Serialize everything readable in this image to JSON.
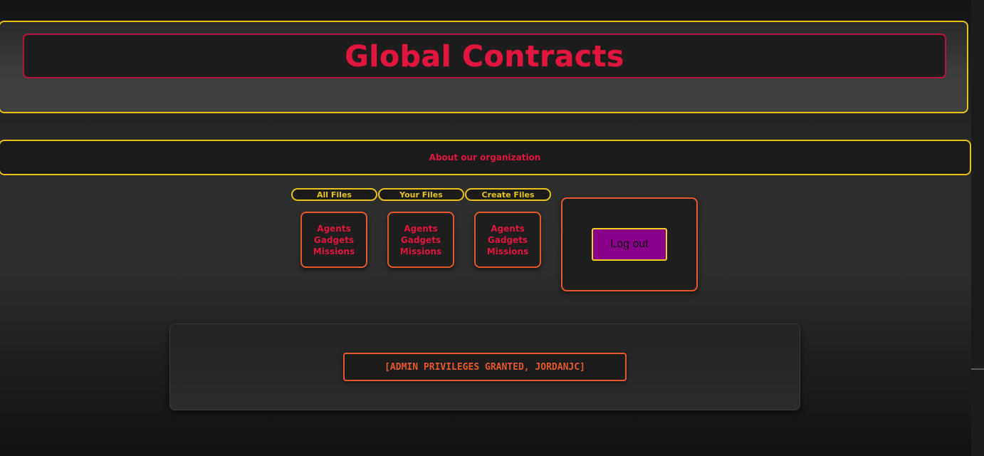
{
  "header": {
    "title": "Global Contracts"
  },
  "about": {
    "link_label": "About our organization"
  },
  "tabs": [
    {
      "label": "All Files"
    },
    {
      "label": "Your Files"
    },
    {
      "label": "Create Files"
    }
  ],
  "cards": [
    {
      "links": [
        "Agents",
        "Gadgets",
        "Missions"
      ]
    },
    {
      "links": [
        "Agents",
        "Gadgets",
        "Missions"
      ]
    },
    {
      "links": [
        "Agents",
        "Gadgets",
        "Missions"
      ]
    }
  ],
  "logout": {
    "label": "Log out"
  },
  "admin": {
    "status_text": "[ADMIN PRIVILEGES GRANTED, JORDANJC]"
  },
  "colors": {
    "accent_red": "#e0163f",
    "accent_yellow": "#e6c21a",
    "accent_orange": "#e4582b",
    "logout_purple": "#8b008b"
  }
}
